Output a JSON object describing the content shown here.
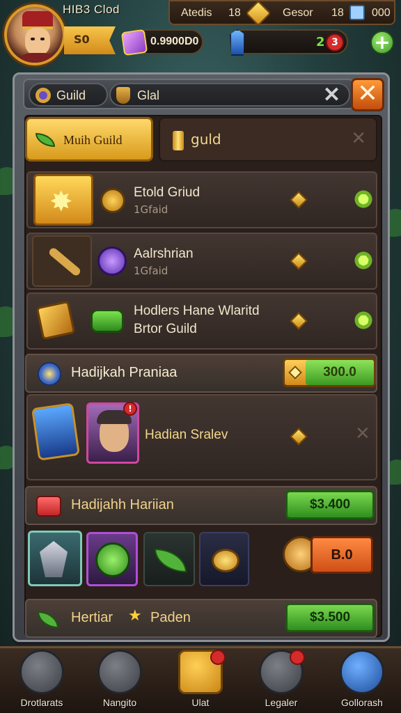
{
  "player": {
    "name": "HIB3 Clod",
    "level_badge": "S0"
  },
  "stats": {
    "stat_a_label": "Atedis",
    "stat_a_value": "18",
    "stat_b_label": "Gesor",
    "stat_b_value": "18",
    "stat_c_value": "000"
  },
  "currency": {
    "cubes": "0.9900D0",
    "crystal_badge_1": "2",
    "crystal_badge_2": "3"
  },
  "header": {
    "tab_guild": "Guild",
    "tab_search": "Glal"
  },
  "tabs": {
    "active": "Muih Guild",
    "secondary": "guld"
  },
  "rows": [
    {
      "title": "Etold Griud",
      "subtitle": "1Gfaid"
    },
    {
      "title": "Aalrshrian",
      "subtitle": "1Gfaid"
    },
    {
      "title": "Hodlers Hane Wlaritd",
      "subtitle": "Brtor Guild"
    }
  ],
  "section1": {
    "title": "Hadijkah Praniaa",
    "value": "300.0"
  },
  "member": {
    "name": "Hadian Sralev"
  },
  "section2": {
    "title": "Hadijahh Hariian",
    "price": "$3.400"
  },
  "section3": {
    "title": "Hertiar",
    "title2": "Paden",
    "price": "$3.500"
  },
  "cost": {
    "value": "B.0"
  },
  "nav": [
    {
      "label": "Drotlarats",
      "icon": "house-icon"
    },
    {
      "label": "Nangito",
      "icon": "tent-icon"
    },
    {
      "label": "Ulat",
      "icon": "scroll-icon"
    },
    {
      "label": "Legaler",
      "icon": "chest-icon"
    },
    {
      "label": "Gollorash",
      "icon": "book-icon"
    }
  ],
  "colors": {
    "accent_gold": "#e0a52a",
    "accent_green": "#4fb52f",
    "panel": "#3c3f45",
    "danger": "#d52b2b"
  }
}
